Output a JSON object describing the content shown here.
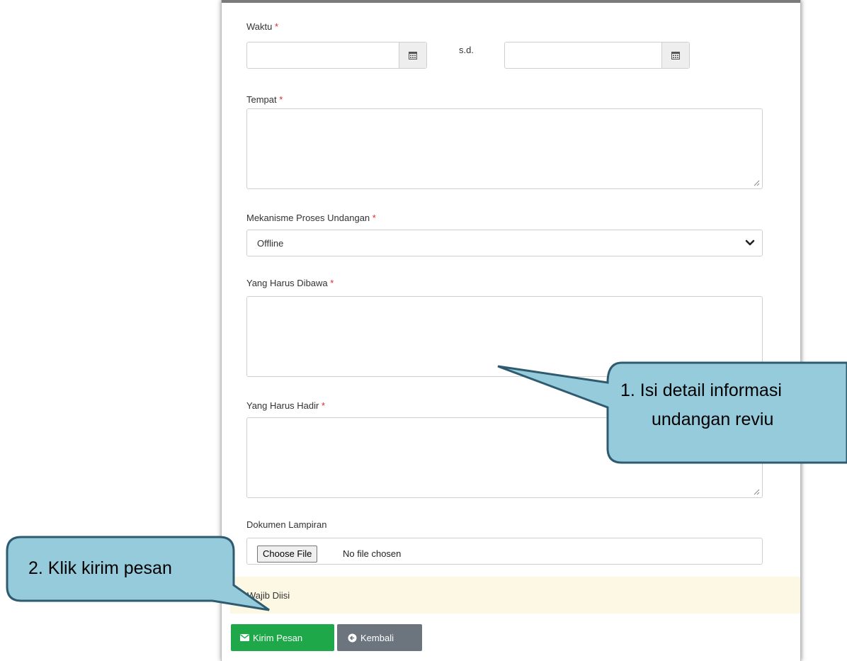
{
  "form": {
    "waktu": {
      "label": "Waktu",
      "required": "*",
      "separator": "s.d.",
      "start_value": "",
      "end_value": ""
    },
    "tempat": {
      "label": "Tempat",
      "required": "*",
      "value": ""
    },
    "mekanisme": {
      "label": "Mekanisme Proses Undangan",
      "required": "*",
      "selected": "Offline"
    },
    "dibawa": {
      "label": "Yang Harus Dibawa",
      "required": "*",
      "value": ""
    },
    "hadir": {
      "label": "Yang Harus Hadir",
      "required": "*",
      "value": ""
    },
    "lampiran": {
      "label": "Dokumen Lampiran",
      "button_label": "Choose File",
      "status": "No file chosen"
    },
    "notice": "Wajib Diisi"
  },
  "buttons": {
    "send_label": "Kirim Pesan",
    "back_label": "Kembali"
  },
  "callouts": {
    "step1_line1": "1.  Isi detail informasi",
    "step1_line2": "undangan reviu",
    "step2": "2. Klik kirim pesan"
  },
  "icons": {
    "calendar": "calendar-icon",
    "chevron": "chevron-down-icon",
    "envelope": "envelope-icon",
    "back": "arrow-circle-left-icon"
  },
  "colors": {
    "required": "#e0262b",
    "send_button": "#1ea84a",
    "back_button": "#6c757d",
    "notice_bg": "#fcf8e3",
    "callout_fill": "#96cbdc",
    "callout_stroke": "#2f5b70"
  }
}
